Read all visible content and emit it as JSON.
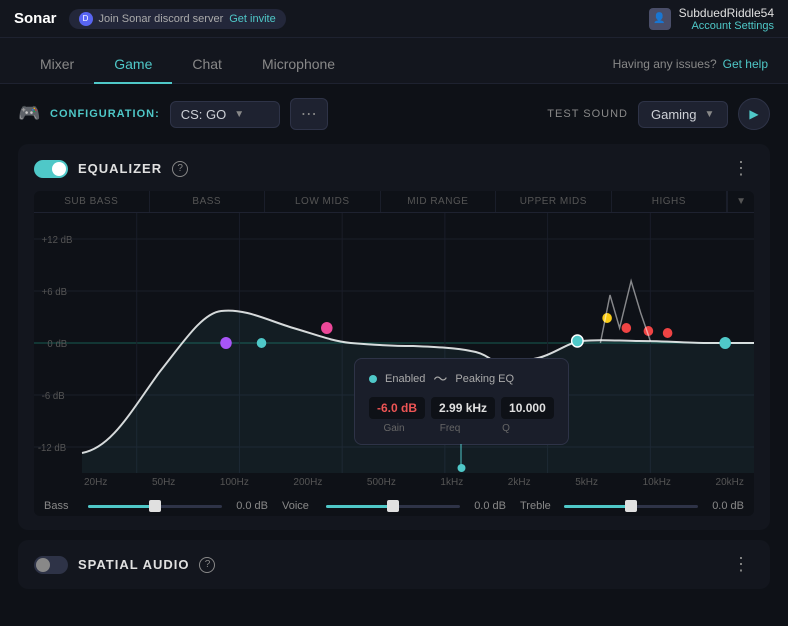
{
  "topbar": {
    "brand": "Sonar",
    "discord_badge": "Join Sonar discord server",
    "invite_label": "Get invite",
    "user_name": "SubduedRiddle54",
    "account_settings_label": "Account Settings"
  },
  "nav": {
    "tabs": [
      {
        "id": "mixer",
        "label": "Mixer"
      },
      {
        "id": "game",
        "label": "Game"
      },
      {
        "id": "chat",
        "label": "Chat"
      },
      {
        "id": "microphone",
        "label": "Microphone"
      }
    ],
    "active_tab": "game",
    "help_text": "Having any issues?",
    "help_link": "Get help"
  },
  "config": {
    "label": "CONFIGURATION:",
    "selected": "CS: GO",
    "more_icon": "⋯",
    "test_sound_label": "TEST SOUND",
    "test_sound_option": "Gaming",
    "play_icon": "▶"
  },
  "equalizer": {
    "title": "EQUALIZER",
    "enabled": true,
    "help_icon": "?",
    "more_icon": "⋮",
    "bands": [
      {
        "label": "SUB BASS"
      },
      {
        "label": "BASS"
      },
      {
        "label": "LOW MIDS"
      },
      {
        "label": "MID RANGE"
      },
      {
        "label": "UPPER MIDS"
      },
      {
        "label": "HIGHS"
      }
    ],
    "freq_labels": [
      "20Hz",
      "50Hz",
      "100Hz",
      "200Hz",
      "500Hz",
      "1kHz",
      "2kHz",
      "5kHz",
      "10kHz",
      "20kHz"
    ],
    "db_labels": [
      "+12 dB",
      "+6 dB",
      "0 dB",
      "-6 dB",
      "-12 dB"
    ],
    "tooltip": {
      "enabled_label": "Enabled",
      "type_label": "Peaking EQ",
      "gain": "-6.0 dB",
      "freq": "2.99 kHz",
      "q": "10.000",
      "gain_label": "Gain",
      "freq_label": "Freq",
      "q_label": "Q"
    },
    "sliders": [
      {
        "label": "Bass",
        "value": "0.0 dB",
        "position": 50
      },
      {
        "label": "Voice",
        "value": "0.0 dB",
        "position": 50
      },
      {
        "label": "Treble",
        "value": "0.0 dB",
        "position": 50
      }
    ]
  },
  "spatial_audio": {
    "title": "SPATIAL AUDIO",
    "enabled": false,
    "help_icon": "?",
    "more_icon": "⋮"
  }
}
